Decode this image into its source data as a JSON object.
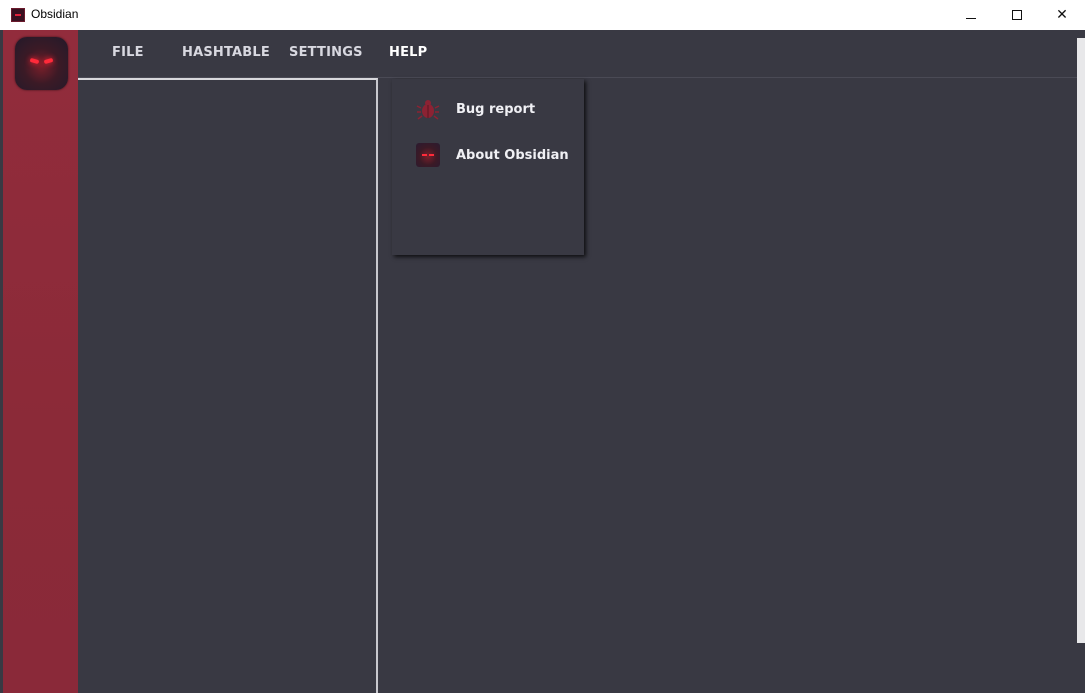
{
  "window": {
    "title": "Obsidian",
    "controls": [
      "minimize",
      "maximize",
      "close"
    ]
  },
  "menubar": {
    "items": [
      {
        "label": "FILE"
      },
      {
        "label": "HASHTABLE"
      },
      {
        "label": "SETTINGS"
      },
      {
        "label": "HELP"
      }
    ],
    "active": "HELP"
  },
  "help_menu": {
    "items": [
      {
        "label": "Bug report",
        "icon": "bug-icon"
      },
      {
        "label": "About Obsidian",
        "icon": "obsidian-logo-icon"
      }
    ]
  },
  "colors": {
    "sidebar": "#922c3c",
    "background": "#393943",
    "menu_text": "#d8d8e0",
    "accent": "#e0203a"
  }
}
